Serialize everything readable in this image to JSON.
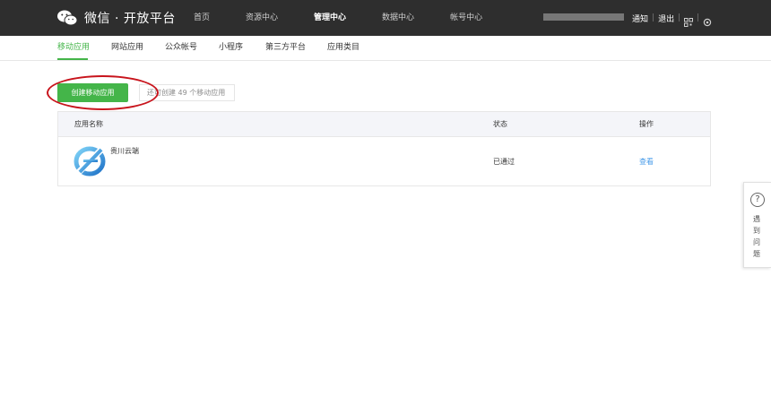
{
  "header": {
    "logo_icon": "wechat-logo-icon",
    "brand": "微信 · 开放平台",
    "nav": [
      {
        "label": "首页",
        "active": false
      },
      {
        "label": "资源中心",
        "active": false
      },
      {
        "label": "管理中心",
        "active": true
      },
      {
        "label": "数据中心",
        "active": false
      },
      {
        "label": "帐号中心",
        "active": false
      }
    ],
    "notify": "通知",
    "logout": "退出",
    "qr_icon": "qr-code-icon",
    "settings_icon": "gear-icon"
  },
  "subnav": {
    "items": [
      {
        "label": "移动应用",
        "active": true
      },
      {
        "label": "网站应用",
        "active": false
      },
      {
        "label": "公众帐号",
        "active": false
      },
      {
        "label": "小程序",
        "active": false
      },
      {
        "label": "第三方平台",
        "active": false
      },
      {
        "label": "应用类目",
        "active": false
      }
    ]
  },
  "toolbar": {
    "create_label": "创建移动应用",
    "remaining_text": "还可创建 49 个移动应用"
  },
  "table": {
    "columns": {
      "name": "应用名称",
      "status": "状态",
      "action": "操作"
    },
    "rows": [
      {
        "name": "贵川云端",
        "status": "已通过",
        "action": "查看",
        "icon": "app-logo-icon"
      }
    ]
  },
  "help": {
    "icon": "question-circle-icon",
    "chars": [
      "遇",
      "到",
      "问",
      "题"
    ]
  },
  "colors": {
    "topbar": "#2e2e2e",
    "accent": "#44b549",
    "link": "#459ae9",
    "highlight_circle": "#c8141c"
  }
}
